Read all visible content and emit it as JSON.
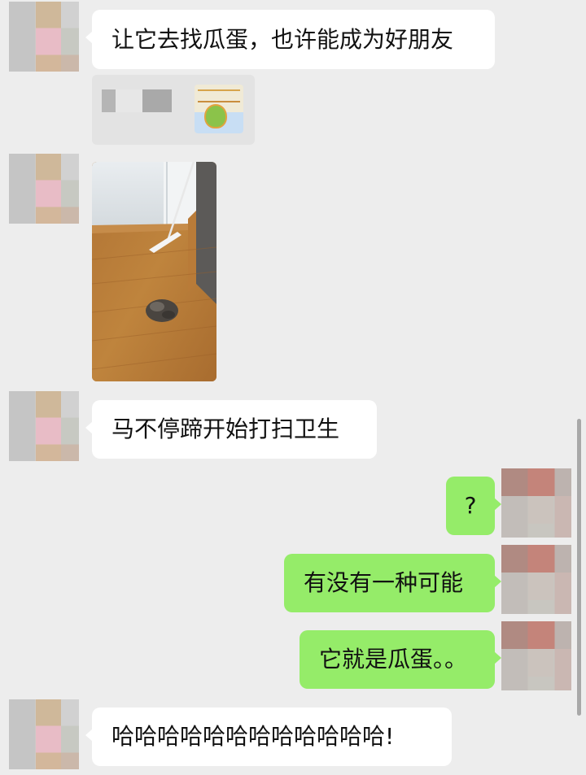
{
  "chat": {
    "messages": [
      {
        "side": "in",
        "type": "text",
        "text": "让它去找瓜蛋，也许能成为好朋友"
      },
      {
        "side": "in",
        "type": "link-card"
      },
      {
        "side": "in",
        "type": "image",
        "subject": "wood-floor-with-mop"
      },
      {
        "side": "in",
        "type": "text",
        "text": "马不停蹄开始打扫卫生"
      },
      {
        "side": "out",
        "type": "text",
        "text": "?"
      },
      {
        "side": "out",
        "type": "text",
        "text": "有没有一种可能"
      },
      {
        "side": "out",
        "type": "text",
        "text": "它就是瓜蛋。。"
      },
      {
        "side": "in",
        "type": "text",
        "text": "哈哈哈哈哈哈哈哈哈哈哈哈!"
      }
    ]
  },
  "colors": {
    "background": "#ededed",
    "incoming_bubble": "#ffffff",
    "outgoing_bubble": "#95ec69"
  }
}
